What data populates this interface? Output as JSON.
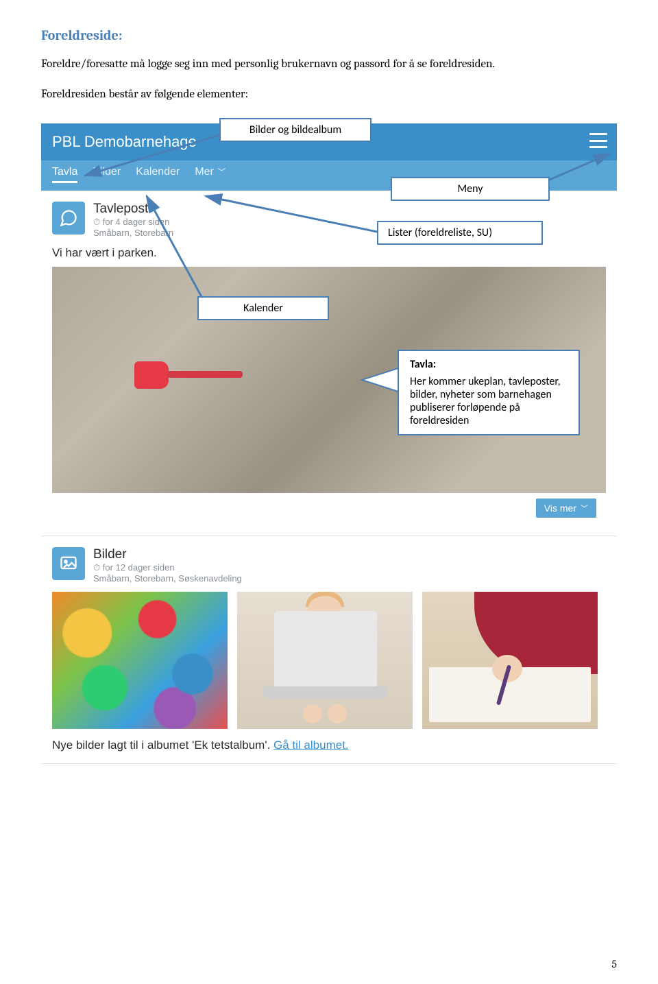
{
  "heading": "Foreldreside:",
  "para1": "Foreldre/foresatte må logge seg inn med personlig brukernavn og passord for å se foreldresiden.",
  "para2": "Foreldresiden består av følgende elementer:",
  "labels": {
    "bilder": "Bilder og bildealbum",
    "meny": "Meny",
    "lister": "Lister (foreldreliste, SU)",
    "kalender": "Kalender"
  },
  "callout": {
    "title": "Tavla:",
    "body": "Her kommer ukeplan, tavleposter, bilder, nyheter som barnehagen publiserer forløpende på foreldresiden"
  },
  "app": {
    "title": "PBL Demobarnehage",
    "nav": {
      "tavla": "Tavla",
      "bilder": "Bilder",
      "kalender": "Kalender",
      "mer": "Mer"
    },
    "post1": {
      "title": "Tavlepost",
      "meta_time": "for 4 dager siden",
      "meta_groups": "Småbarn, Storebarn",
      "body": "Vi har vært i parken."
    },
    "vismer": "Vis mer",
    "post2": {
      "title": "Bilder",
      "meta_time": "for 12 dager siden",
      "meta_groups": "Småbarn, Storebarn, Søskenavdeling",
      "caption_pre": "Nye bilder lagt til i albumet 'Ek tetstalbum'. ",
      "caption_link": "Gå til albumet."
    }
  },
  "page_number": "5"
}
